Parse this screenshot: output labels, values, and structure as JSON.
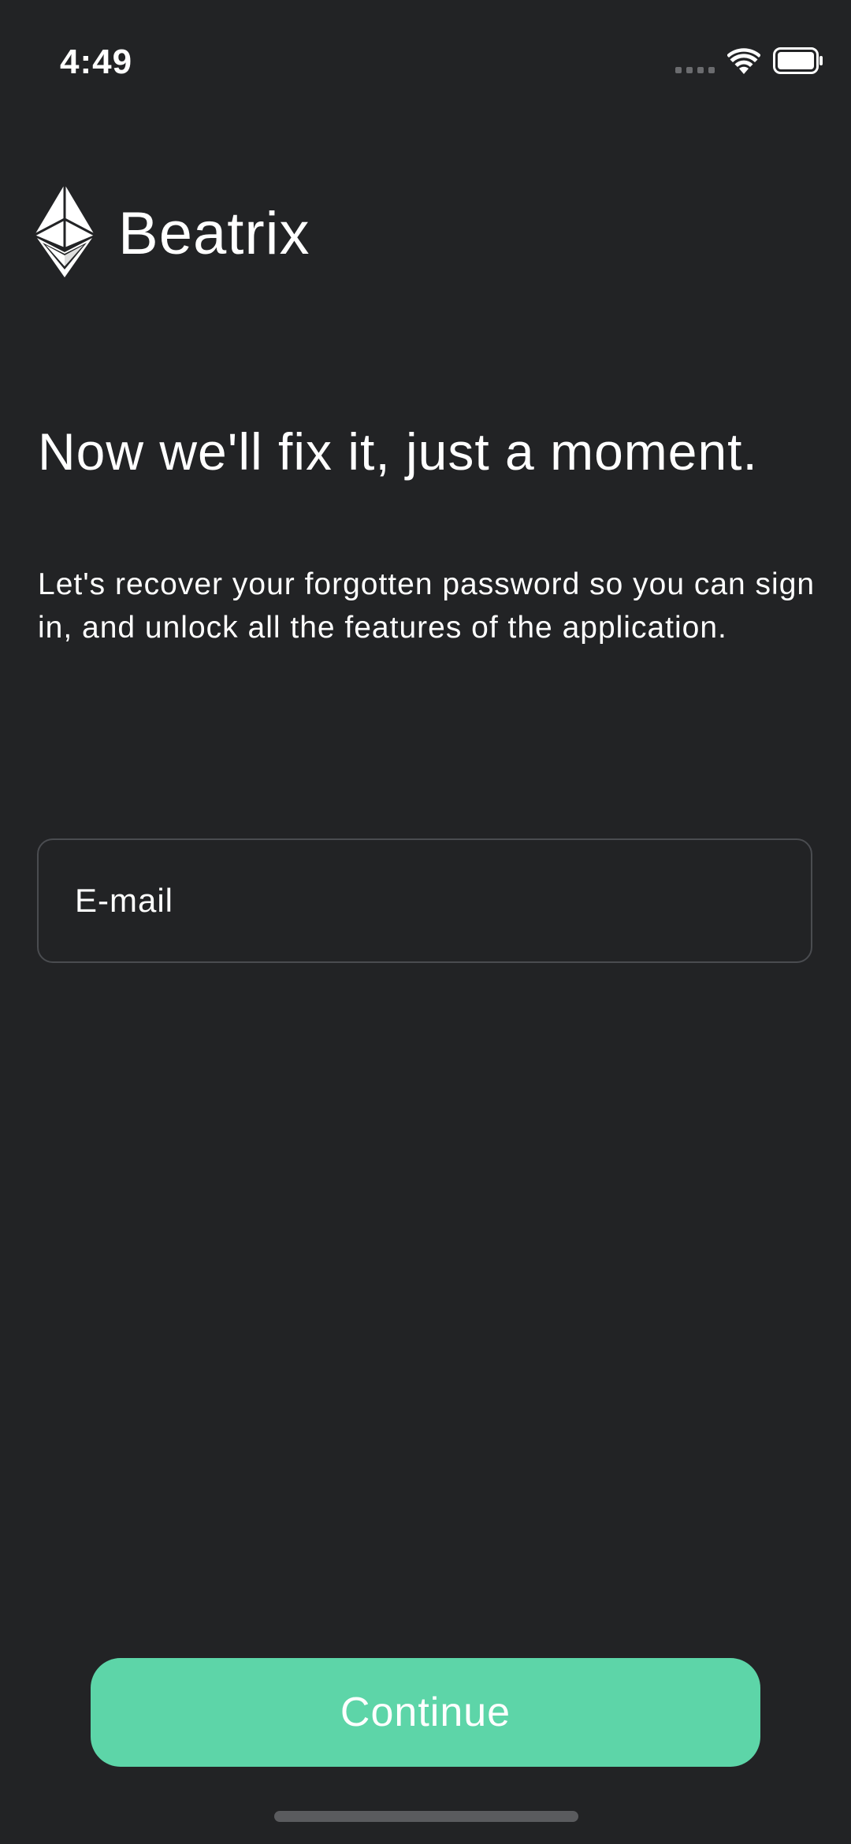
{
  "status_bar": {
    "time": "4:49"
  },
  "brand": {
    "name": "Beatrix",
    "logo_icon": "ethereum-diamond-icon"
  },
  "content": {
    "headline": "Now we'll fix it, just a moment.",
    "subtitle": "Let's recover your forgotten password so you can sign in, and unlock all the features of the application."
  },
  "form": {
    "email_placeholder": "E-mail",
    "email_value": ""
  },
  "actions": {
    "continue_label": "Continue"
  },
  "colors": {
    "background": "#222325",
    "accent": "#5dd5a8",
    "field_border": "#4a4c50",
    "text": "#ffffff"
  }
}
